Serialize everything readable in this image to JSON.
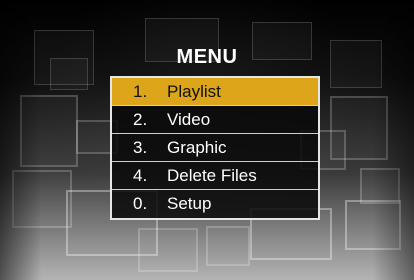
{
  "screen": {
    "title": "MENU"
  },
  "menu": {
    "selected_index": 0,
    "highlight_color": "#dca51a",
    "items": [
      {
        "number": "1.",
        "label": "Playlist"
      },
      {
        "number": "2.",
        "label": "Video"
      },
      {
        "number": "3.",
        "label": "Graphic"
      },
      {
        "number": "4.",
        "label": "Delete Files"
      },
      {
        "number": "0.",
        "label": "Setup"
      }
    ]
  }
}
